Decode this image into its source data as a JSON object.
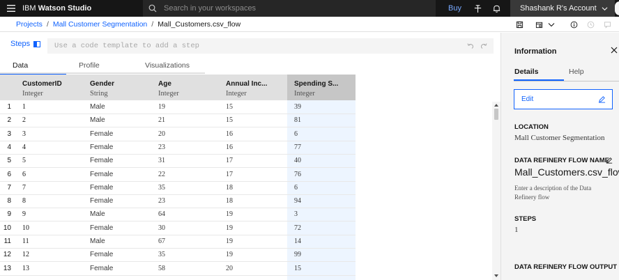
{
  "topbar": {
    "brand_prefix": "IBM",
    "brand_name": "Watson Studio",
    "search_placeholder": "Search in your workspaces",
    "buy_label": "Buy",
    "account_label": "Shashank R's Account"
  },
  "breadcrumb": {
    "items": [
      "Projects",
      "Mall Customer Segmentation",
      "Mall_Customers.csv_flow"
    ],
    "separator": "/"
  },
  "steps": {
    "label": "Steps",
    "template_placeholder": "Use a code template to add a step"
  },
  "data_tabs": [
    "Data",
    "Profile",
    "Visualizations"
  ],
  "table": {
    "columns": [
      {
        "name": "CustomerID",
        "type": "Integer"
      },
      {
        "name": "Gender",
        "type": "String"
      },
      {
        "name": "Age",
        "type": "Integer"
      },
      {
        "name": "Annual Inc...",
        "type": "Integer"
      },
      {
        "name": "Spending S...",
        "type": "Integer"
      }
    ],
    "rows": [
      [
        "1",
        "1",
        "Male",
        "19",
        "15",
        "39"
      ],
      [
        "2",
        "2",
        "Male",
        "21",
        "15",
        "81"
      ],
      [
        "3",
        "3",
        "Female",
        "20",
        "16",
        "6"
      ],
      [
        "4",
        "4",
        "Female",
        "23",
        "16",
        "77"
      ],
      [
        "5",
        "5",
        "Female",
        "31",
        "17",
        "40"
      ],
      [
        "6",
        "6",
        "Female",
        "22",
        "17",
        "76"
      ],
      [
        "7",
        "7",
        "Female",
        "35",
        "18",
        "6"
      ],
      [
        "8",
        "8",
        "Female",
        "23",
        "18",
        "94"
      ],
      [
        "9",
        "9",
        "Male",
        "64",
        "19",
        "3"
      ],
      [
        "10",
        "10",
        "Female",
        "30",
        "19",
        "72"
      ],
      [
        "11",
        "11",
        "Male",
        "67",
        "19",
        "14"
      ],
      [
        "12",
        "12",
        "Female",
        "35",
        "19",
        "99"
      ],
      [
        "13",
        "13",
        "Female",
        "58",
        "20",
        "15"
      ]
    ]
  },
  "info_panel": {
    "title": "Information",
    "tabs": [
      "Details",
      "Help"
    ],
    "edit_label": "Edit",
    "location_label": "LOCATION",
    "location_value": "Mall Customer Segmentation",
    "flow_name_label": "DATA REFINERY FLOW NAME",
    "flow_name_value": "Mall_Customers.csv_flow",
    "flow_description": "Enter a description of the Data Refinery flow",
    "steps_label": "STEPS",
    "steps_value": "1",
    "output_label": "DATA REFINERY FLOW OUTPUT"
  },
  "colors": {
    "topbar_bg": "#161616",
    "accent": "#0f62fe",
    "selected_column": "#edf5ff",
    "panel_bg": "#f4f4f4"
  },
  "icons": [
    "menu-icon",
    "search-icon",
    "pin-icon",
    "notification-icon",
    "chevron-down-icon",
    "save-icon",
    "schedule-icon",
    "info-icon",
    "undo-icon",
    "redo-icon",
    "close-icon",
    "edit-icon",
    "side-panel-icon"
  ]
}
